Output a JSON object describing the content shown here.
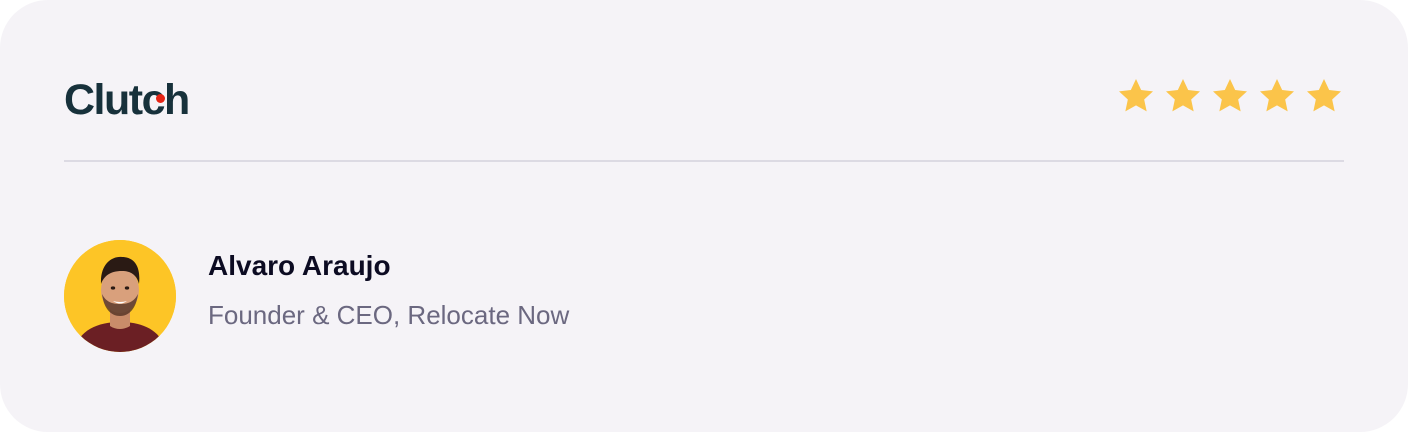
{
  "card": {
    "logo": {
      "text": "Clutch",
      "icon": "clutch-logo",
      "dot_color": "#e62415"
    },
    "rating": {
      "value": 5,
      "max": 5,
      "icon": "star-icon",
      "color": "#fbc44a"
    },
    "reviewer": {
      "name": "Alvaro Araujo",
      "title": "Founder & CEO, Relocate Now",
      "avatar_bg": "#fdc526"
    }
  }
}
